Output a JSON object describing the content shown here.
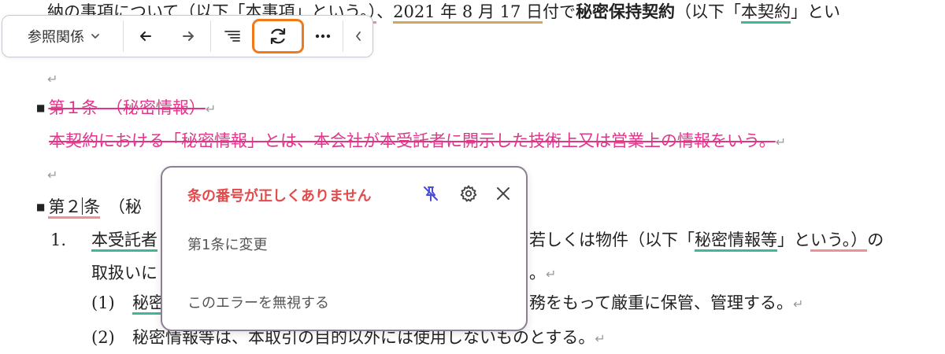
{
  "document": {
    "line0": {
      "lead": "納の事項について（以下「本事項」と",
      "underlined1": "いう。）",
      "comma": "、",
      "date": "2021 年 8 月 17 日",
      "mid": "付で",
      "bold_term": "秘密保持契約",
      "paren": "（以下「",
      "defined": "本契約",
      "tail": "」とい"
    },
    "para_mark": "↵",
    "article1": {
      "heading": "第１条　（秘密情報）",
      "body": "本契約における「秘密情報」とは、本会社が本受託者に開示した技術上又は営業上の情報をいう。"
    },
    "article2": {
      "heading_a": "第２",
      "heading_b": "条",
      "heading_c": "　（秘"
    },
    "item1": {
      "num": "1.",
      "start": "本受託者",
      "right_text": "若しくは物件（以下「",
      "right_term": "秘密情報等",
      "right_mid": "」と",
      "right_tail": "いう。）",
      "right_end": "の",
      "line2_start": "取扱いに",
      "line2_end": "。"
    },
    "sub1": {
      "num": "(1)",
      "start": "秘密",
      "right_text": "務をもって厳重に保管、管理する。"
    },
    "sub2": {
      "num": "(2)",
      "text": "秘密情報等は、本取引の目的以外には使用しないものとする。"
    }
  },
  "toolbar": {
    "reference_label": "参照関係",
    "icons": [
      "chevron-down-icon",
      "arrow-left-icon",
      "arrow-right-icon",
      "list-icon",
      "refresh-icon",
      "more-icon",
      "collapse-icon"
    ],
    "highlight_color": "#f07a1a"
  },
  "popup": {
    "title": "条の番号が正しくありません",
    "suggestion": "第1条に変更",
    "ignore": "このエラーを無視する",
    "title_color": "#e24b4b",
    "icons": [
      "unpin-icon",
      "gear-icon",
      "close-icon"
    ]
  },
  "colors": {
    "deleted": "#e0368a",
    "underline_teal": "#3fb89a",
    "underline_pink": "#f08f98",
    "underline_gold": "#cfa85a"
  }
}
